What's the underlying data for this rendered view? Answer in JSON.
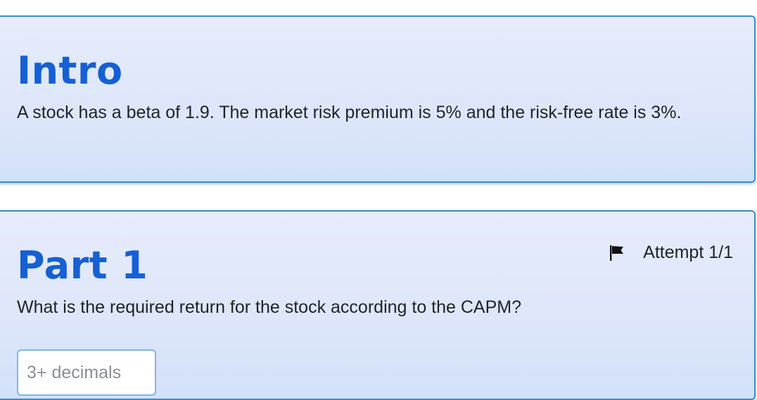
{
  "intro": {
    "title": "Intro",
    "text": "A stock has a beta of 1.9. The market risk premium is 5% and the risk-free rate is 3%."
  },
  "part1": {
    "title": "Part 1",
    "attempt": "Attempt 1/1",
    "question": "What is the required return for the stock according to the CAPM?",
    "answer_placeholder": "3+ decimals",
    "answer_value": ""
  },
  "icons": {
    "flag": "flag-icon"
  },
  "colors": {
    "heading": "#1560d4",
    "card_border": "#3a8fd0",
    "card_background": "#e2eafa",
    "input_border": "#7fb6e6"
  }
}
